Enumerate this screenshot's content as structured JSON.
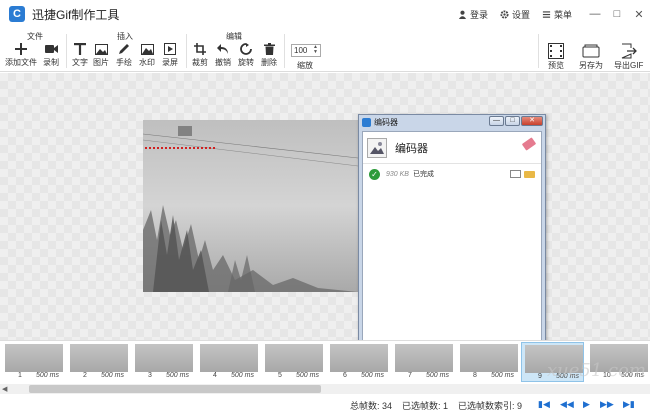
{
  "app": {
    "title": "迅捷Gif制作工具"
  },
  "titlebar": {
    "login": "登录",
    "settings": "设置",
    "menu": "菜单",
    "minimize": "—",
    "restore": "□",
    "close": "✕"
  },
  "ribbon": {
    "groups": {
      "file": "文件",
      "insert": "插入",
      "edit": "编辑"
    },
    "file_buttons": {
      "add_file": "添加文件",
      "record": "录制"
    },
    "insert_buttons": {
      "text": "文字",
      "image": "图片",
      "draw": "手绘",
      "watermark": "水印",
      "screen": "录屏"
    },
    "edit_buttons": {
      "crop": "裁剪",
      "undo": "撤销",
      "rotate": "旋转",
      "delete": "删除"
    },
    "zoom": {
      "value": "100",
      "label": "缩放"
    },
    "right_buttons": {
      "preview": "预览",
      "save_as": "另存为",
      "export": "导出GIF"
    }
  },
  "dialog": {
    "title": "编码器",
    "heading": "编码器",
    "rows": [
      {
        "size": "930 KB",
        "status": "已完成"
      }
    ],
    "buttons": {
      "minimize": "—",
      "restore": "□",
      "close": "✕"
    }
  },
  "frames": [
    {
      "num": "1",
      "duration": "500 ms"
    },
    {
      "num": "2",
      "duration": "500 ms"
    },
    {
      "num": "3",
      "duration": "500 ms"
    },
    {
      "num": "4",
      "duration": "500 ms"
    },
    {
      "num": "5",
      "duration": "500 ms"
    },
    {
      "num": "6",
      "duration": "500 ms"
    },
    {
      "num": "7",
      "duration": "500 ms"
    },
    {
      "num": "8",
      "duration": "500 ms"
    },
    {
      "num": "9",
      "duration": "500 ms"
    },
    {
      "num": "10",
      "duration": "500 ms"
    }
  ],
  "status": {
    "total_frames": "总帧数: 34",
    "selected_frames": "已选帧数: 1",
    "selected_index": "已选帧数索引: 9"
  },
  "watermark": "xue51.com"
}
